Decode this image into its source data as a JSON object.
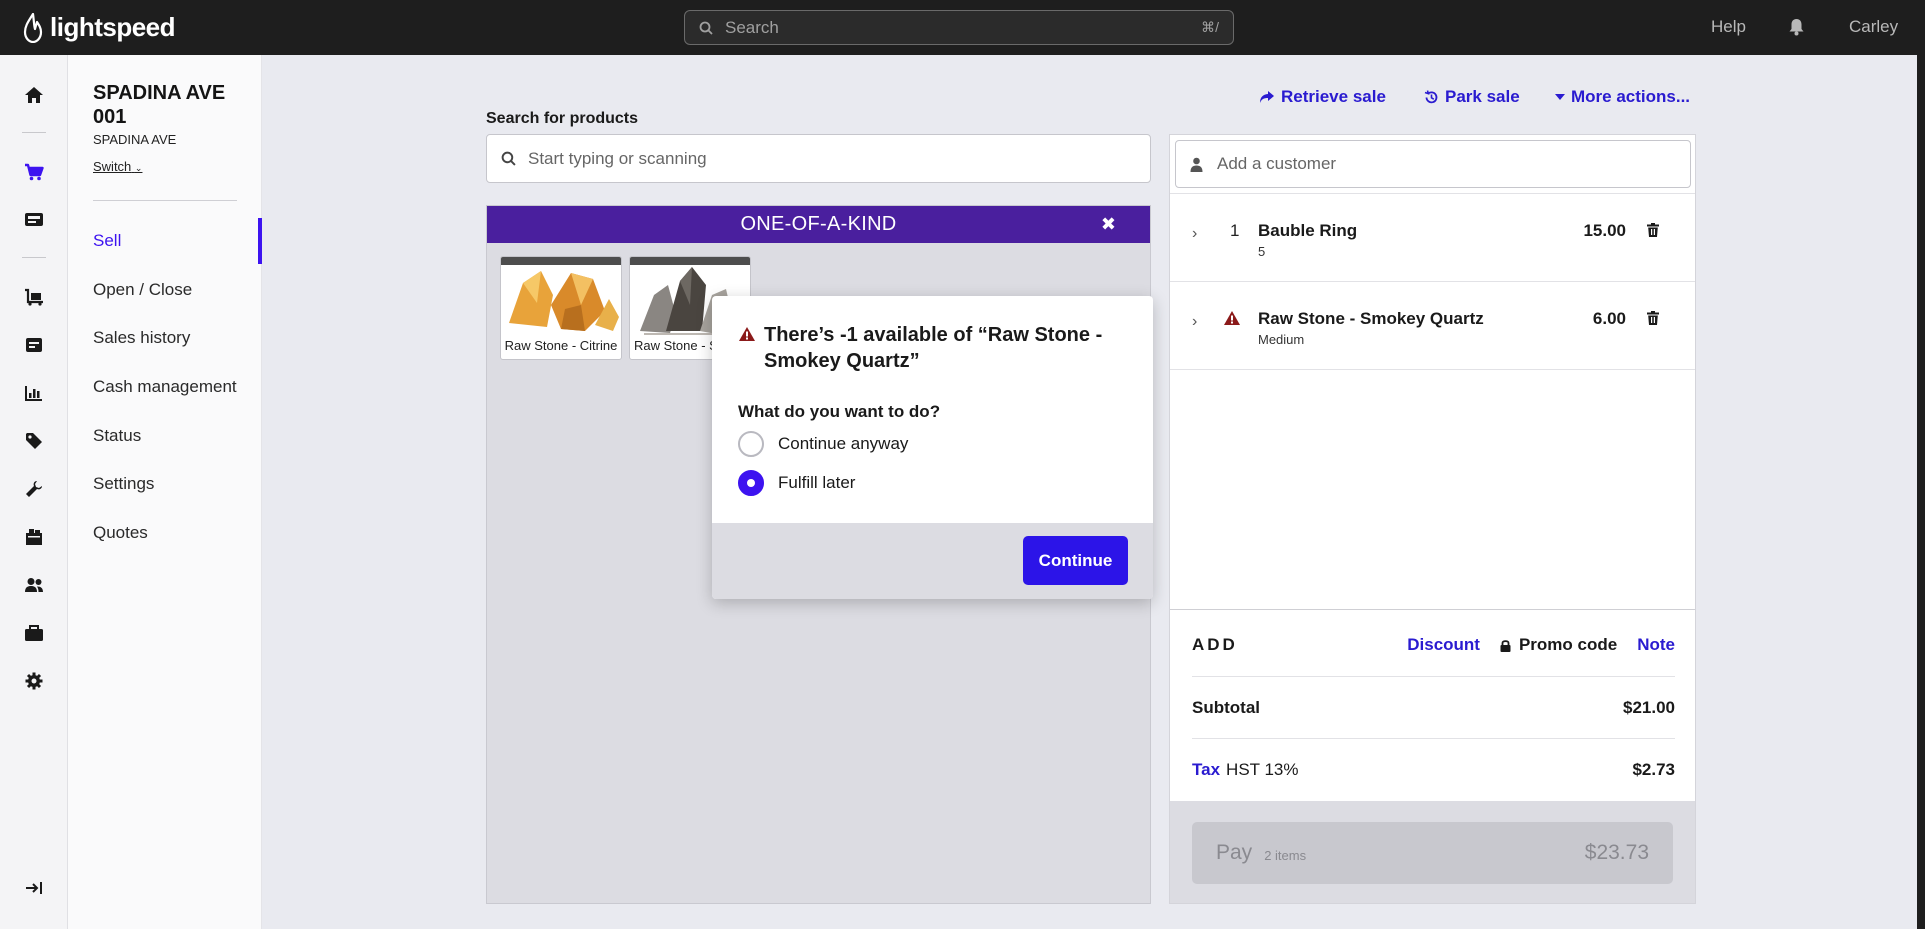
{
  "app": {
    "brand": "lightspeed",
    "search_placeholder": "Search",
    "search_shortcut": "⌘/",
    "help": "Help",
    "user": "Carley"
  },
  "rail_icons": [
    "home-icon",
    "cart-icon",
    "register-icon",
    "stock-icon",
    "invoice-icon",
    "reports-icon",
    "tag-icon",
    "tools-icon",
    "inventory-icon",
    "customers-icon",
    "briefcase-icon",
    "settings-icon",
    "expand-icon"
  ],
  "store": {
    "name": "SPADINA AVE 001",
    "sub": "SPADINA AVE",
    "switch": "Switch"
  },
  "nav": [
    {
      "label": "Sell",
      "active": true
    },
    {
      "label": "Open / Close"
    },
    {
      "label": "Sales history"
    },
    {
      "label": "Cash management"
    },
    {
      "label": "Status"
    },
    {
      "label": "Settings"
    },
    {
      "label": "Quotes"
    }
  ],
  "actions": {
    "retrieve": "Retrieve sale",
    "park": "Park sale",
    "more": "More actions..."
  },
  "products": {
    "label": "Search for products",
    "placeholder": "Start typing or scanning",
    "group": "ONE-OF-A-KIND",
    "tiles": [
      {
        "name": "Raw Stone - Citrine"
      },
      {
        "name": "Raw Stone - Smokey Quartz"
      }
    ]
  },
  "dialog": {
    "title": "There’s -1 available of “Raw Stone - Smokey Quartz”",
    "question": "What do you want to do?",
    "options": [
      {
        "label": "Continue anyway",
        "selected": false
      },
      {
        "label": "Fulfill later",
        "selected": true
      }
    ],
    "continue": "Continue"
  },
  "cart": {
    "customer_placeholder": "Add a customer",
    "lines": [
      {
        "qty": "1",
        "name": "Bauble Ring",
        "sub": "5",
        "price": "15.00",
        "warning": false
      },
      {
        "qty": "",
        "name": "Raw Stone - Smokey Quartz",
        "sub": "Medium",
        "price": "6.00",
        "warning": true
      }
    ],
    "add_label": "ADD",
    "discount": "Discount",
    "promo": "Promo code",
    "note": "Note",
    "subtotal_label": "Subtotal",
    "subtotal": "$21.00",
    "tax_label": "Tax",
    "tax_desc": "HST 13%",
    "tax": "$2.73",
    "pay_label": "Pay",
    "pay_count": "2 items",
    "pay_total": "$23.73"
  },
  "colors": {
    "accent": "#3D13F0",
    "link": "#2A1BD0",
    "group_header": "#4A1F9E",
    "warning": "#8B1A1A",
    "topbar": "#1E1E1E"
  }
}
